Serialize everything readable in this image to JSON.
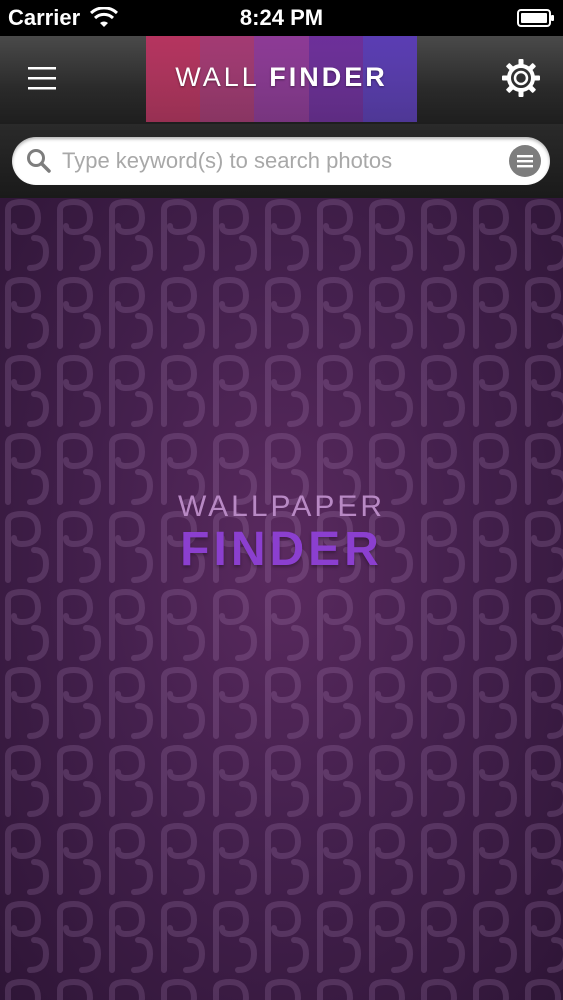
{
  "status_bar": {
    "carrier": "Carrier",
    "time": "8:24 PM",
    "wifi_icon": "wifi-icon",
    "battery_icon": "battery-icon"
  },
  "nav_bar": {
    "menu_icon": "hamburger-menu-icon",
    "settings_icon": "gear-icon",
    "logo_word_1": "WALL",
    "logo_word_2": "FINDER",
    "logo_stripe_colors": [
      "#b5345f",
      "#a33a73",
      "#8d3a96",
      "#6d2f9a",
      "#5a3db3"
    ]
  },
  "search": {
    "placeholder": "Type keyword(s) to search photos",
    "value": "",
    "search_icon": "magnifier-icon",
    "list_icon": "list-icon"
  },
  "main": {
    "brand_top": "WALLPAPER",
    "brand_bottom": "FINDER"
  },
  "colors": {
    "accent_purple": "#8b3fcf",
    "brand_light": "#b889c4",
    "background_purple": "#44204d"
  }
}
